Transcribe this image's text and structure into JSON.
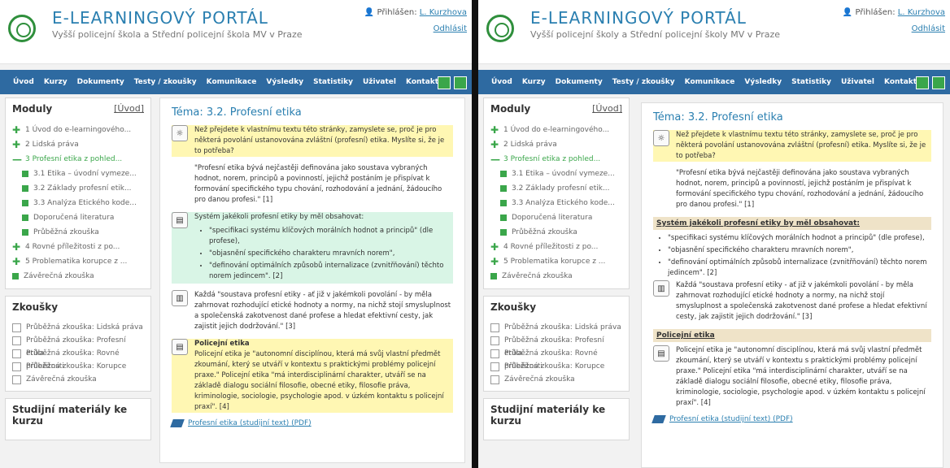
{
  "left": {
    "header": {
      "title": "E-LEARNINGOVÝ PORTÁL",
      "subtitle": "Vyšší policejní škola a Střední policejní škola MV v Praze",
      "login_label": "Přihlášen:",
      "login_user": "L. Kurzhova",
      "logout": "Odhlásit"
    },
    "nav": [
      "Úvod",
      "Kurzy",
      "Dokumenty",
      "Testy / zkoušky",
      "Komunikace",
      "Výsledky",
      "Statistiky",
      "Uživatel",
      "Kontakty"
    ],
    "modules": {
      "title": "Moduly",
      "home_link": "[Úvod]",
      "items": [
        {
          "label": "1 Úvod do e-learningového...",
          "type": "plus"
        },
        {
          "label": "2 Lidská práva",
          "type": "plus"
        },
        {
          "label": "3 Profesní etika z pohled...",
          "type": "minus"
        },
        {
          "label": "3.1 Etika – úvodní vymeze...",
          "type": "sub"
        },
        {
          "label": "3.2 Základy profesní etik...",
          "type": "sub"
        },
        {
          "label": "3.3 Analýza Etického kode...",
          "type": "sub"
        },
        {
          "label": "Doporučená literatura",
          "type": "sub"
        },
        {
          "label": "Průběžná zkouška",
          "type": "sub"
        },
        {
          "label": "4 Rovné příležitosti z po...",
          "type": "plus"
        },
        {
          "label": "5 Problematika korupce z ...",
          "type": "plus"
        },
        {
          "label": "Závěrečná zkouška",
          "type": "sq"
        }
      ]
    },
    "exams": {
      "title": "Zkoušky",
      "items": [
        "Průběžná zkouška: Lidská práva",
        "Průběžná zkouška: Profesní etika",
        "Průběžná zkouška: Rovné příležitosti",
        "Průběžná zkouška: Korupce",
        "Závěrečná zkouška"
      ]
    },
    "materials": {
      "title": "Studijní materiály ke kurzu"
    },
    "content": {
      "topic": "Téma: 3.2. Profesní etika",
      "intro": "Než přejdete k vlastnímu textu této stránky, zamyslete se, proč je pro některá povolání ustanovována zvláštní (profesní) etika. Myslíte si, že je to potřeba?",
      "definition": "\"Profesní etika bývá nejčastěji definována jako soustava vybraných hodnot, norem, principů a povinností, jejichž postáním je přispívat k formování specifického typu chování, rozhodování a jednání, žádoucího pro danou profesi.\" [1]",
      "system_title": "Systém jakékoli profesní etiky by měl obsahovat:",
      "bullets": [
        "\"specifikaci systému klíčových morálních hodnot a principů\" (dle profese),",
        "\"objasnění specifického charakteru mravních norem\",",
        "\"definování optimálních způsobů internalizace (zvnitřňování) těchto norem jedincem\". [2]"
      ],
      "every": "Každá \"soustava profesní etiky - ať již v jakémkoli povolání - by měla zahrnovat rozhodující etické hodnoty a normy, na nichž stojí smysluplnost a společenská zakotvenost dané profese a hledat efektivní cesty, jak zajistit jejich dodržování.\" [3]",
      "police_title": "Policejní etika",
      "police_text": "Policejní etika je \"autonomní disciplínou, která má svůj vlastní předmět zkoumání, který se utváří v kontextu s praktickými problémy policejní praxe.\" Policejní etika \"má interdisciplinární charakter, utváří se na základě dialogu sociální filosofie, obecné etiky, filosofie práva, kriminologie, sociologie, psychologie apod. v úzkém kontaktu s policejní praxí\". [4]",
      "pdf": "Profesní etika (studijní text) (PDF)"
    }
  },
  "right": {
    "header": {
      "title": "E-LEARNINGOVÝ PORTÁL",
      "subtitle": "Vyšší policejní školy a Střední policejní školy MV v Praze",
      "login_label": "Přihlášen:",
      "login_user": "L. Kurzhova",
      "logout": "Odhlásit"
    },
    "nav": [
      "Úvod",
      "Kurzy",
      "Dokumenty",
      "Testy / zkoušky",
      "Komunikace",
      "Výsledky",
      "Statistiky",
      "Uživatel",
      "Kontakty"
    ],
    "modules": {
      "title": "Moduly",
      "home_link": "[Úvod]",
      "items": [
        {
          "label": "1 Úvod do e-learningového...",
          "type": "plus"
        },
        {
          "label": "2 Lidská práva",
          "type": "plus"
        },
        {
          "label": "3 Profesní etika z pohled...",
          "type": "minus"
        },
        {
          "label": "3.1 Etika – úvodní vymeze...",
          "type": "sub"
        },
        {
          "label": "3.2 Základy profesní etik...",
          "type": "sub"
        },
        {
          "label": "3.3 Analýza Etického kode...",
          "type": "sub"
        },
        {
          "label": "Doporučená literatura",
          "type": "sub"
        },
        {
          "label": "Průběžná zkouška",
          "type": "sub"
        },
        {
          "label": "4 Rovné příležitosti z po...",
          "type": "plus"
        },
        {
          "label": "5 Problematika korupce z ...",
          "type": "plus"
        },
        {
          "label": "Závěrečná zkouška",
          "type": "sq"
        }
      ]
    },
    "exams": {
      "title": "Zkoušky",
      "items": [
        "Průběžná zkouška: Lidská práva",
        "Průběžná zkouška: Profesní etika",
        "Průběžná zkouška: Rovné příležitosti",
        "Průběžná zkouška: Korupce",
        "Závěrečná zkouška"
      ]
    },
    "materials": {
      "title": "Studijní materiály ke kurzu"
    },
    "content": {
      "topic": "Téma: 3.2. Profesní etika",
      "intro": "Než přejdete k vlastnímu textu této stránky, zamyslete se, proč je pro některá povolání ustanovována zvláštní (profesní) etika. Myslíte si, že je to potřeba?",
      "definition": "\"Profesní etika bývá nejčastěji definována jako soustava vybraných hodnot, norem, principů a povinností, jejichž postáním je přispívat k formování specifického typu chování, rozhodování a jednání, žádoucího pro danou profesi.\" [1]",
      "system_title": "Systém jakékoli profesní etiky by měl obsahovat:",
      "bullets": [
        "\"specifikaci systému klíčových morálních hodnot a principů\" (dle profese),",
        "\"objasnění specifického charakteru mravních norem\",",
        "\"definování optimálních způsobů internalizace (zvnitřňování) těchto norem jedincem\". [2]"
      ],
      "every": "Každá \"soustava profesní etiky - ať již v jakémkoli povolání - by měla zahrnovat rozhodující etické hodnoty a normy, na nichž stojí smysluplnost a společenská zakotvenost dané profese a hledat efektivní cesty, jak zajistit jejich dodržování.\" [3]",
      "police_title": "Policejní etika",
      "police_text": "Policejní etika je \"autonomní disciplínou, která má svůj vlastní předmět zkoumání, který se utváří v kontextu s praktickými problémy policejní praxe.\" Policejní etika \"má interdisciplinární charakter, utváří se na základě dialogu sociální filosofie, obecné etiky, filosofie práva, kriminologie, sociologie, psychologie apod. v úzkém kontaktu s policejní praxí\". [4]",
      "pdf": "Profesní etika (studijní text) (PDF)"
    }
  }
}
